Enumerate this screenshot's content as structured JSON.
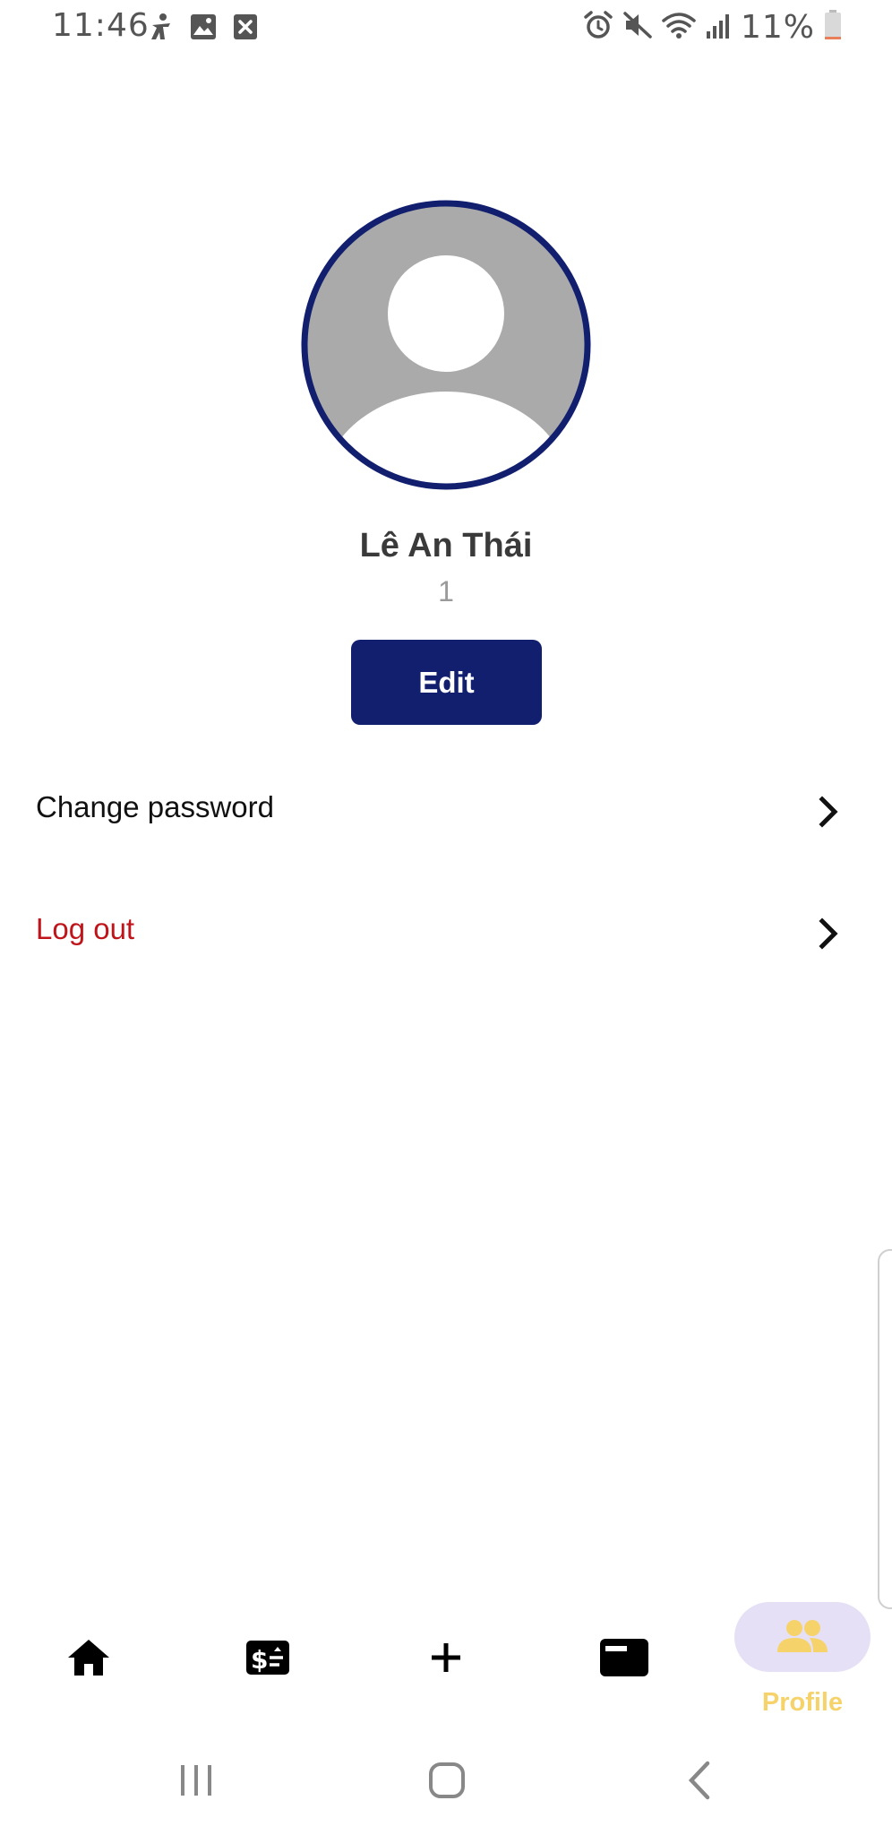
{
  "status_bar": {
    "time": "11:46",
    "battery_percent": "11%",
    "left_icons": [
      "accessibility-icon",
      "image-icon",
      "close-box-icon"
    ],
    "right_icons": [
      "alarm-icon",
      "mute-icon",
      "wifi-icon",
      "signal-icon",
      "battery-low-icon"
    ],
    "battery_level": 0.11,
    "battery_color": "#e97e5b"
  },
  "profile": {
    "avatar_icon": "default-avatar-icon",
    "avatar_border_color": "#111f6e",
    "name": "Lê An Thái",
    "id": "1",
    "edit_label": "Edit"
  },
  "menu": {
    "items": [
      {
        "label": "Change password",
        "icon": "chevron-right-icon",
        "color": "#111111"
      },
      {
        "label": "Log out",
        "icon": "chevron-right-icon",
        "color": "#c0141b"
      }
    ]
  },
  "bottom_nav": {
    "items": [
      {
        "icon": "home-icon",
        "label": ""
      },
      {
        "icon": "budget-icon",
        "label": ""
      },
      {
        "icon": "plus-icon",
        "label": ""
      },
      {
        "icon": "card-icon",
        "label": ""
      },
      {
        "icon": "group-icon",
        "label": "Profile",
        "active": true
      }
    ],
    "active_color": "#f6d36a",
    "active_bg": "#e6e0f6"
  },
  "system_nav": {
    "buttons": [
      "recents-icon",
      "home-button-icon",
      "back-icon"
    ]
  },
  "colors": {
    "primary": "#111f6e",
    "danger": "#c0141b",
    "accent": "#f6d36a"
  }
}
